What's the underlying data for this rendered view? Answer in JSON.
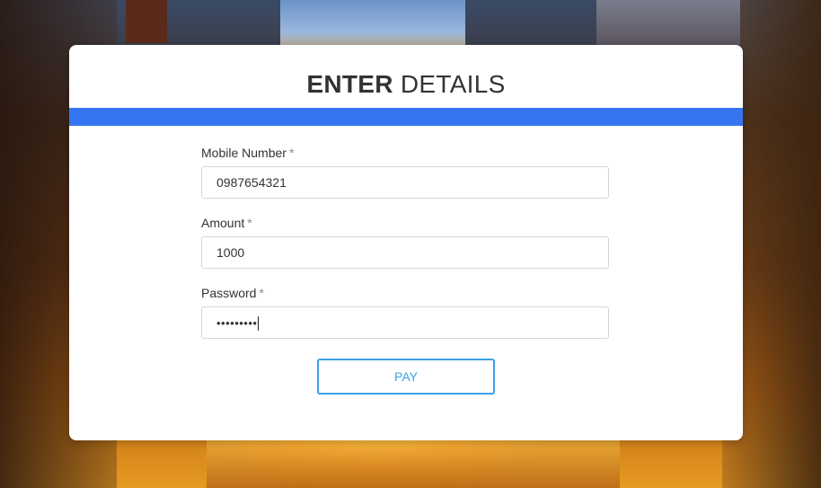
{
  "colors": {
    "accent_bar": "#3575f0",
    "button_border": "#3aa0e8",
    "button_text": "#3aa0e8",
    "card_bg": "#ffffff"
  },
  "form": {
    "title_bold": "ENTER",
    "title_rest": "DETAILS",
    "required_mark": "*",
    "fields": [
      {
        "label": "Mobile Number",
        "value": "0987654321",
        "type": "text"
      },
      {
        "label": "Amount",
        "value": "1000",
        "type": "text"
      },
      {
        "label": "Password",
        "value": "•••••••••",
        "type": "password"
      }
    ],
    "submit_label": "PAY"
  }
}
